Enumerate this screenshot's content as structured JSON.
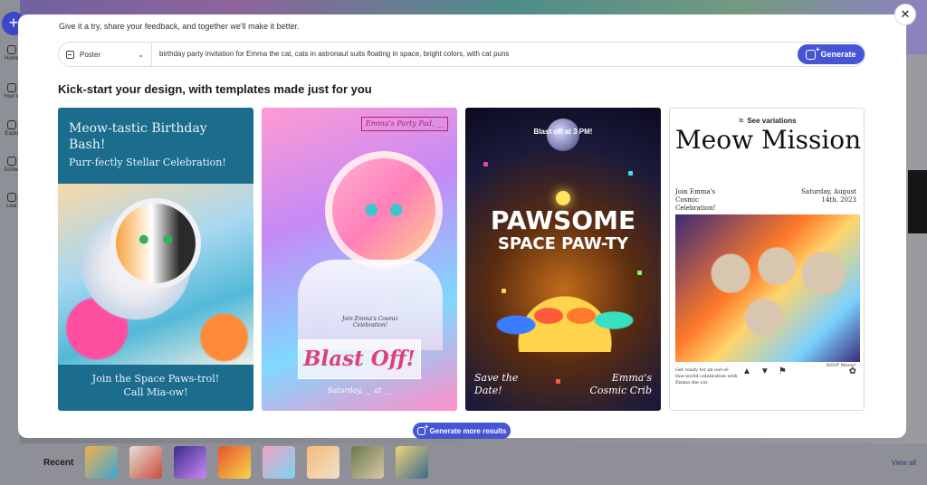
{
  "background": {
    "nav": [
      "Home",
      "Your st",
      "Explo",
      "Sched",
      "Lear"
    ],
    "recent_label": "Recent",
    "view_all": "View all",
    "accent": "#3b46c8"
  },
  "modal": {
    "feedback_text": "Give it a try, share your feedback, and together we'll make it better.",
    "prompt": {
      "type_value": "Poster",
      "text": "birthday party invitation for Emma the cat, cats in astronaut suits floating in space, bright colors, with cat puns",
      "generate_label": "Generate"
    },
    "section_title": "Kick-start your design, with templates made just for you",
    "more_label": "Generate more results",
    "accent": "#4655d6"
  },
  "cards": [
    {
      "title": "Meow-tastic Birthday Bash!",
      "subtitle": "Purr-fectly Stellar Celebration!",
      "footer_line1": "Join the Space Paws-trol!",
      "footer_line2": "Call Mia-ow!"
    },
    {
      "tag": "Emma's Party Pad, __",
      "small": "Join Emma's Cosmic Celebration!",
      "headline": "Blast Off!",
      "date": "Saturday, __ at __"
    },
    {
      "top": "Blast off at 3 PM!",
      "headline_1": "PAWSOME",
      "headline_2": "SPACE PAW-TY",
      "bottom_left_1": "Save the",
      "bottom_left_2": "Date!",
      "bottom_right_1": "Emma's",
      "bottom_right_2": "Cosmic Crib"
    },
    {
      "see_variations": "See variations",
      "title": "Meow Mission",
      "left_1": "Join Emma's",
      "left_2": "Cosmic",
      "left_3": "Celebration!",
      "right_1": "Saturday, August",
      "right_2": "14th, 2023",
      "footer": "Get ready for an out-of-this-world celebration with Emma the cat.",
      "rsvp": "RSVP Meow!"
    }
  ]
}
